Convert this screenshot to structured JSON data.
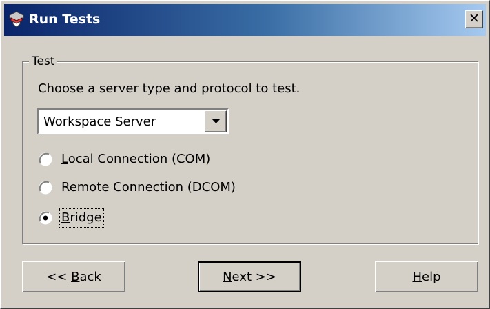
{
  "window": {
    "title": "Run Tests",
    "title_icon": "test-tube-icon",
    "close_glyph": "✕"
  },
  "group": {
    "legend": "Test",
    "instruction": "Choose a server type and protocol to test."
  },
  "server_type": {
    "selected": "Workspace Server",
    "icon": "chevron-down-icon"
  },
  "radios": [
    {
      "pre": "",
      "key": "L",
      "post": "ocal Connection (COM)",
      "selected": false
    },
    {
      "pre": "Remote Connection (",
      "key": "D",
      "post": "COM)",
      "selected": false
    },
    {
      "pre": "",
      "key": "B",
      "post": "ridge",
      "selected": true
    }
  ],
  "buttons": {
    "back": {
      "pre": "<< ",
      "key": "B",
      "post": "ack"
    },
    "next": {
      "pre": "",
      "key": "N",
      "post": "ext >>"
    },
    "help": {
      "pre": "",
      "key": "H",
      "post": "elp"
    }
  },
  "colors": {
    "face": "#d4d0c8",
    "title_start": "#0a246a",
    "title_end": "#a6caf0"
  }
}
